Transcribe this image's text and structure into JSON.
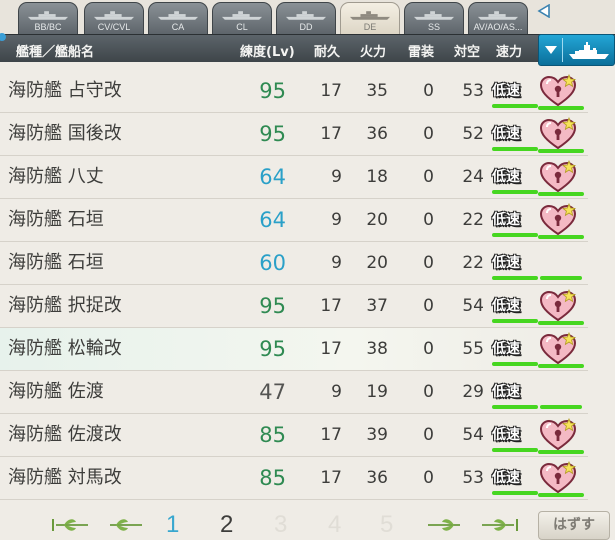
{
  "tabs": [
    {
      "label": "BB/BC",
      "active": false
    },
    {
      "label": "CV/CVL",
      "active": false
    },
    {
      "label": "CA",
      "active": false
    },
    {
      "label": "CL",
      "active": false
    },
    {
      "label": "DD",
      "active": false
    },
    {
      "label": "DE",
      "active": true
    },
    {
      "label": "SS",
      "active": false
    },
    {
      "label": "AV/AO/AS...",
      "active": false
    }
  ],
  "header": {
    "type_name": "艦種／艦船名",
    "level": "練度(Lv)",
    "hp": "耐久",
    "firepower": "火力",
    "torpedo": "雷装",
    "antiair": "対空",
    "speed": "速力"
  },
  "ships": [
    {
      "name": "海防艦 占守改",
      "lv": "95",
      "lv_color": "green",
      "hp": "17",
      "fp": "35",
      "tp": "0",
      "aa": "53",
      "speed": "低速",
      "heart": true,
      "bar1": 1.0,
      "bar2": 0.0,
      "highlight": false
    },
    {
      "name": "海防艦 国後改",
      "lv": "95",
      "lv_color": "green",
      "hp": "17",
      "fp": "36",
      "tp": "0",
      "aa": "52",
      "speed": "低速",
      "heart": true,
      "bar1": 1.0,
      "bar2": 0.0,
      "highlight": false
    },
    {
      "name": "海防艦 八丈",
      "lv": "64",
      "lv_color": "blue",
      "hp": "9",
      "fp": "18",
      "tp": "0",
      "aa": "24",
      "speed": "低速",
      "heart": true,
      "bar1": 1.0,
      "bar2": 0.0,
      "highlight": false
    },
    {
      "name": "海防艦 石垣",
      "lv": "64",
      "lv_color": "blue",
      "hp": "9",
      "fp": "20",
      "tp": "0",
      "aa": "22",
      "speed": "低速",
      "heart": true,
      "bar1": 1.0,
      "bar2": 0.0,
      "highlight": false
    },
    {
      "name": "海防艦 石垣",
      "lv": "60",
      "lv_color": "blue",
      "hp": "9",
      "fp": "20",
      "tp": "0",
      "aa": "22",
      "speed": "低速",
      "heart": false,
      "bar1": 1.0,
      "bar2": 0.5,
      "highlight": false
    },
    {
      "name": "海防艦 択捉改",
      "lv": "95",
      "lv_color": "green",
      "hp": "17",
      "fp": "37",
      "tp": "0",
      "aa": "54",
      "speed": "低速",
      "heart": true,
      "bar1": 1.0,
      "bar2": 0.0,
      "highlight": false
    },
    {
      "name": "海防艦 松輪改",
      "lv": "95",
      "lv_color": "green",
      "hp": "17",
      "fp": "38",
      "tp": "0",
      "aa": "55",
      "speed": "低速",
      "heart": true,
      "bar1": 1.0,
      "bar2": 0.0,
      "highlight": true
    },
    {
      "name": "海防艦 佐渡",
      "lv": "47",
      "lv_color": "dark",
      "hp": "9",
      "fp": "19",
      "tp": "0",
      "aa": "29",
      "speed": "低速",
      "heart": false,
      "bar1": 1.0,
      "bar2": 0.5,
      "highlight": false
    },
    {
      "name": "海防艦 佐渡改",
      "lv": "85",
      "lv_color": "green",
      "hp": "17",
      "fp": "39",
      "tp": "0",
      "aa": "54",
      "speed": "低速",
      "heart": true,
      "bar1": 1.0,
      "bar2": 0.0,
      "highlight": false
    },
    {
      "name": "海防艦 対馬改",
      "lv": "85",
      "lv_color": "green",
      "hp": "17",
      "fp": "36",
      "tp": "0",
      "aa": "53",
      "speed": "低速",
      "heart": true,
      "bar1": 1.0,
      "bar2": 0.0,
      "highlight": false
    }
  ],
  "pager": {
    "pages": [
      {
        "label": "1",
        "state": "current"
      },
      {
        "label": "2",
        "state": "normal"
      },
      {
        "label": "3",
        "state": "disabled"
      },
      {
        "label": "4",
        "state": "disabled"
      },
      {
        "label": "5",
        "state": "disabled"
      }
    ],
    "unset_label": "はずす"
  },
  "colors": {
    "lv_green": "#2f8a52",
    "lv_blue": "#2aa0c8",
    "bar_green": "#46d620",
    "header_bg": "#4a5257",
    "accent_blue": "#1a8fc0"
  },
  "icons": {
    "heart": "pink-lock-heart-icon",
    "first": "first-page-icon",
    "prev": "prev-page-icon",
    "next": "next-page-icon",
    "last": "last-page-icon"
  }
}
